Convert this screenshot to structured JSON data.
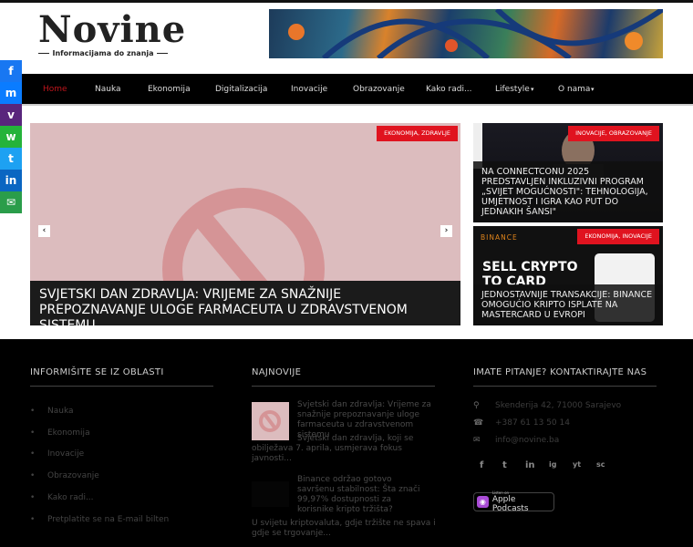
{
  "logo": {
    "name": "Novine",
    "tagline": "Informacijama do znanja"
  },
  "nav": [
    {
      "label": "Home"
    },
    {
      "label": "Nauka"
    },
    {
      "label": "Ekonomija"
    },
    {
      "label": "Digitalizacija"
    },
    {
      "label": "Inovacije"
    },
    {
      "label": "Obrazovanje"
    },
    {
      "label": "Kako radi..."
    },
    {
      "label": "Lifestyle",
      "caret": "▾"
    },
    {
      "label": "O nama",
      "caret": "▾"
    }
  ],
  "share": [
    "f",
    "m",
    "v",
    "w",
    "t",
    "in",
    "✉"
  ],
  "slider": {
    "badge": "EKONOMIJA, ZDRAVLJE",
    "title": "Svjetski dan zdravlja: Vrijeme za snažnije prepoznavanje uloge farmaceuta u zdravstvenom sistemu",
    "prev": "‹",
    "next": "›"
  },
  "cards": [
    {
      "badge": "INOVACIJE, OBRAZOVANJE",
      "title": "Na ConnectConu 2025 predstavljen inkluzivni program „Svijet mogućnosti\": tehnologija, umjetnost i igra kao put do jednakih šansi\""
    },
    {
      "badge": "EKONOMIJA, INOVACIJE",
      "brand": "BINANCE",
      "promo1": "SELL CRYPTO",
      "promo2": "TO CARD",
      "title": "Jednostavnije transakcije: Binance omogućio kripto isplate na Mastercard u Evropi"
    }
  ],
  "footer": {
    "col1": {
      "heading": "INFORMIŠITE SE IZ OBLASTI",
      "items": [
        "Nauka",
        "Ekonomija",
        "Inovacije",
        "Obrazovanje",
        "Kako radi...",
        "Pretplatite se na E-mail bilten"
      ]
    },
    "col2": {
      "heading": "NAJNOVIJE",
      "posts": [
        {
          "title": "Svjetski dan zdravlja: Vrijeme za snažnije prepoznavanje uloge farmaceuta u zdravstvenom sistemu",
          "excerpt": "Svjetski dan zdravlja, koji se obilježava 7. aprila, usmjerava fokus javnosti..."
        },
        {
          "title": "Binance održao gotovo savršenu stabilnost: Šta znači 99,97% dostupnosti za korisnike kripto tržišta?",
          "excerpt": "U svijetu kriptovaluta, gdje tržište ne spava i gdje se trgovanje..."
        }
      ]
    },
    "col3": {
      "heading": "IMATE PITANJE? KONTAKTIRAJTE NAS",
      "address": "Skenderija 42, 71000 Sarajevo",
      "phone": "+387 61 13 50 14",
      "email": "info@novine.ba",
      "social": [
        "f",
        "t",
        "in",
        "ig",
        "yt",
        "sc"
      ],
      "podcast_small": "Listen on",
      "podcast": "Apple Podcasts"
    }
  }
}
